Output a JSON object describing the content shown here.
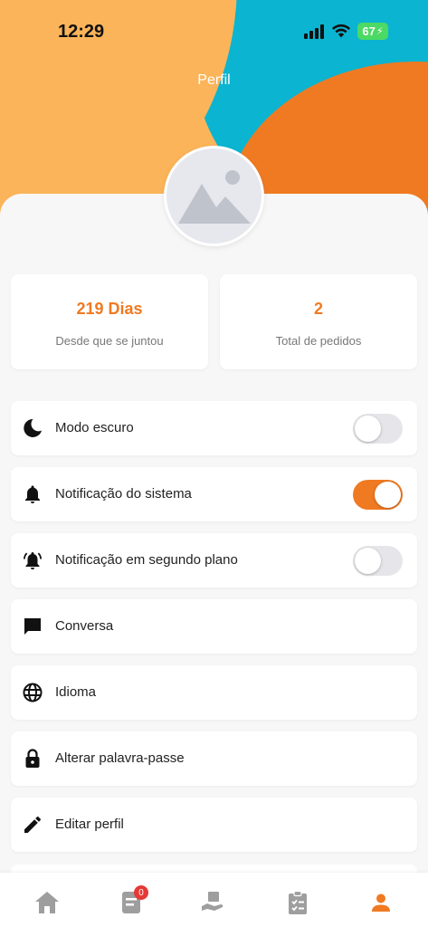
{
  "status_bar": {
    "time": "12:29",
    "battery": "67"
  },
  "header": {
    "title": "Perfil"
  },
  "stats": [
    {
      "value": "219 Dias",
      "label": "Desde que se juntou"
    },
    {
      "value": "2",
      "label": "Total de pedidos"
    }
  ],
  "settings": [
    {
      "label": "Modo escuro",
      "icon": "moon-icon",
      "toggle": false
    },
    {
      "label": "Notificação do sistema",
      "icon": "bell-icon",
      "toggle": true
    },
    {
      "label": "Notificação em segundo plano",
      "icon": "bell-ring-icon",
      "toggle": false
    },
    {
      "label": "Conversa",
      "icon": "chat-icon"
    },
    {
      "label": "Idioma",
      "icon": "globe-icon"
    },
    {
      "label": "Alterar palavra-passe",
      "icon": "lock-icon"
    },
    {
      "label": "Editar perfil",
      "icon": "pencil-icon"
    }
  ],
  "bottom_nav": {
    "items": [
      "home-icon",
      "orders-icon",
      "delivery-icon",
      "checklist-icon",
      "profile-icon"
    ],
    "orders_badge": "0",
    "active": "profile-icon"
  },
  "colors": {
    "accent": "#f07a22",
    "cyan": "#0bb4d0",
    "yellow": "#fbb45a",
    "background": "#f7f7f7"
  }
}
